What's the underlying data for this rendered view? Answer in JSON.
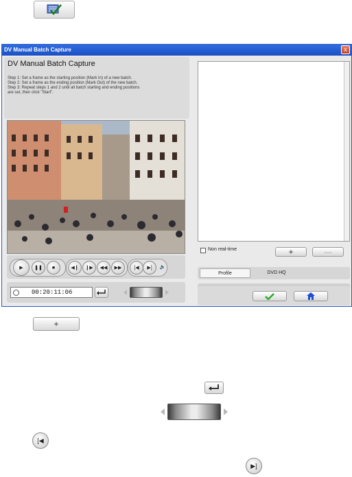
{
  "top_icon": {
    "name": "batch-capture-icon"
  },
  "dialog": {
    "title": "DV Manual Batch Capture",
    "close_label": "x",
    "heading": "DV Manual Batch Capture",
    "steps": [
      "Step 1: Set a frame as the starting position (Mark In) of a new batch.",
      "Step 2: Set a frame as the ending position (Mark Out) of the new batch.",
      "Step 3: Repeat steps 1 and 2 until all batch starting and ending positions",
      "are set, then click \"Start\"."
    ],
    "timecode": "00:20:11:06",
    "non_realtime_label": "Non real-time",
    "add_label": "+",
    "remove_label": "—",
    "tabs": [
      "Profile",
      "DVD HQ"
    ]
  },
  "legend": {
    "add_label": "+"
  },
  "colors": {
    "titlebar": "#1b4fc4",
    "ok_green": "#2fa82f",
    "home_blue": "#1f4fd0"
  }
}
